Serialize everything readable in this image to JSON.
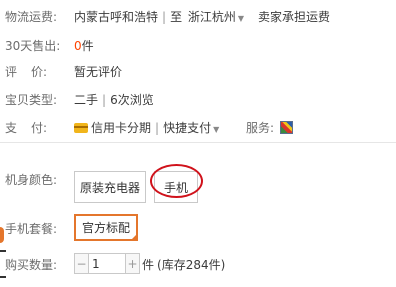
{
  "shipping": {
    "label": "物流运费:",
    "from": "内蒙古呼和浩特",
    "to_word": "至",
    "destination": "浙江杭州",
    "fee": "卖家承担运费"
  },
  "sales": {
    "label": "30天售出:",
    "count": "0",
    "unit": "件"
  },
  "rating": {
    "label_a": "评",
    "label_b": "价:",
    "value": "暂无评价"
  },
  "item_type": {
    "label": "宝贝类型:",
    "value": "二手",
    "views": "6次浏览"
  },
  "payment": {
    "label_a": "支",
    "label_b": "付:",
    "card": "信用卡分期",
    "quick": "快捷支付",
    "service_label": "服务:"
  },
  "body_color": {
    "label": "机身颜色:",
    "options": [
      "原装充电器",
      "手机"
    ]
  },
  "package": {
    "label": "手机套餐:",
    "selected": "官方标配"
  },
  "quantity": {
    "label": "购买数量:",
    "minus": "−",
    "value": "1",
    "plus": "+",
    "unit": "件",
    "stock": "(库存284件)"
  },
  "colors": {
    "accent": "#e4762c",
    "price": "#ff4400",
    "circle": "#d0121b"
  }
}
